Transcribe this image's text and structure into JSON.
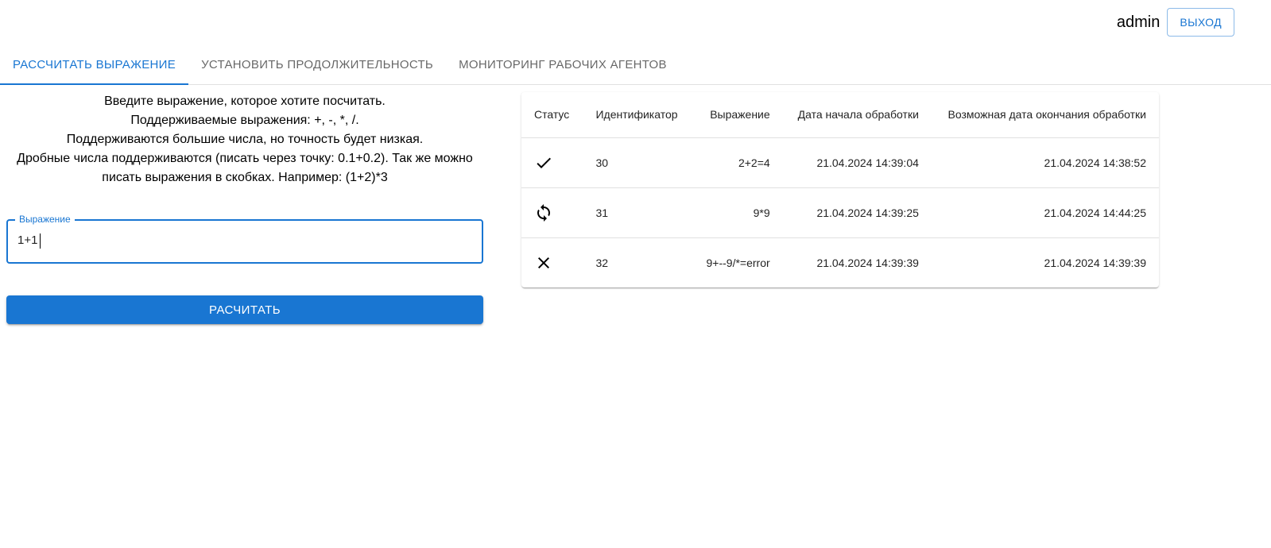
{
  "header": {
    "username": "admin",
    "logout_label": "Выход"
  },
  "tabs": [
    {
      "label": "Рассчитать выражение",
      "active": true
    },
    {
      "label": "Установить продолжительность",
      "active": false
    },
    {
      "label": "Мониторинг рабочих агентов",
      "active": false
    }
  ],
  "instructions": [
    "Введите выражение, которое хотите посчитать.",
    "Поддерживаемые выражения: +, -, *, /.",
    "Поддерживаются большие числа, но точность будет низкая.",
    "Дробные числа поддерживаются (писать через точку: 0.1+0.2). Так же можно",
    "писать выражения в скобках. Например: (1+2)*3"
  ],
  "expression_field": {
    "label": "Выражение",
    "value": "1+1"
  },
  "calculate_button": "Расчитать",
  "table": {
    "headers": [
      "Статус",
      "Идентификатор",
      "Выражение",
      "Дата начала обработки",
      "Возможная дата окончания обработки"
    ],
    "rows": [
      {
        "status_icon": "check-icon",
        "id": "30",
        "expression": "2+2=4",
        "start": "21.04.2024 14:39:04",
        "end": "21.04.2024 14:38:52"
      },
      {
        "status_icon": "sync-icon",
        "id": "31",
        "expression": "9*9",
        "start": "21.04.2024 14:39:25",
        "end": "21.04.2024 14:44:25"
      },
      {
        "status_icon": "close-icon",
        "id": "32",
        "expression": "9+--9/*=error",
        "start": "21.04.2024 14:39:39",
        "end": "21.04.2024 14:39:39"
      }
    ]
  },
  "colors": {
    "primary": "#1976d2"
  }
}
